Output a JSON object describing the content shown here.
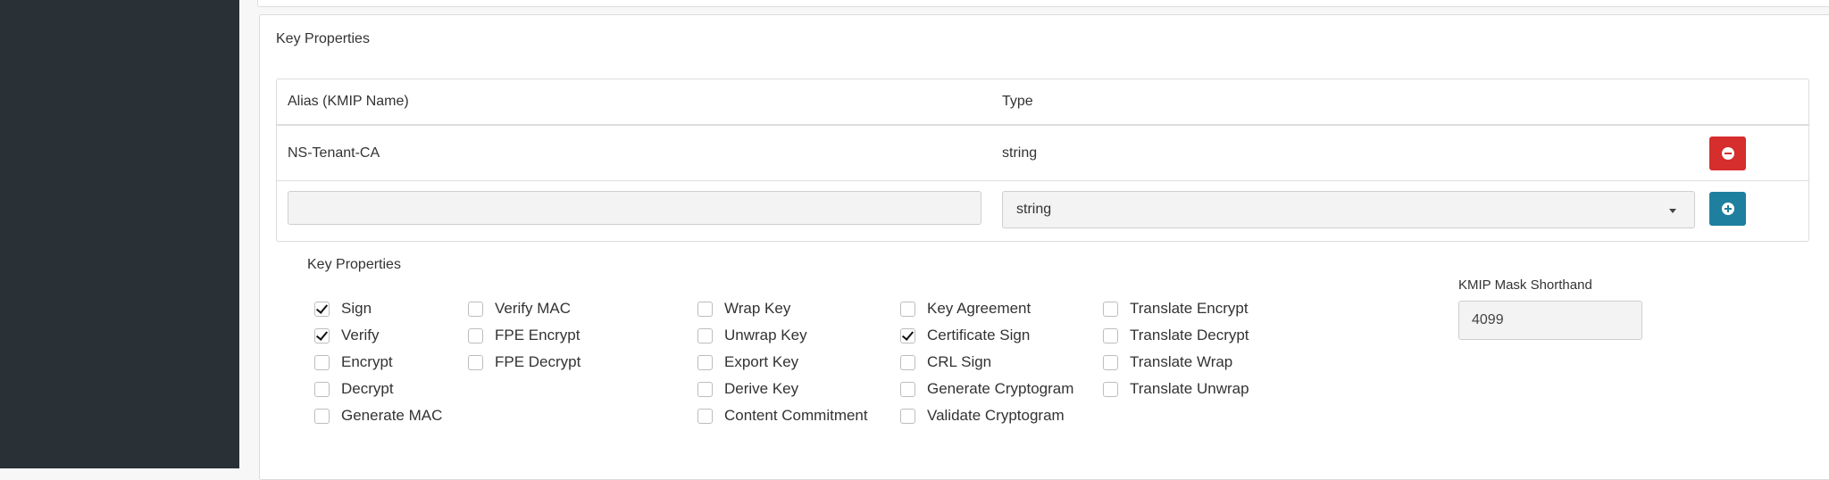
{
  "panel": {
    "title": "Key Properties"
  },
  "alias_table": {
    "headers": {
      "alias": "Alias (KMIP Name)",
      "type": "Type"
    },
    "rows": [
      {
        "alias": "NS-Tenant-CA",
        "type": "string"
      }
    ],
    "new_row": {
      "alias_value": "",
      "type_selected": "string"
    }
  },
  "key_properties": {
    "title": "Key Properties",
    "col1": [
      {
        "label": "Sign",
        "checked": true
      },
      {
        "label": "Verify",
        "checked": true
      },
      {
        "label": "Encrypt",
        "checked": false
      },
      {
        "label": "Decrypt",
        "checked": false
      },
      {
        "label": "Generate MAC",
        "checked": false
      }
    ],
    "col2": [
      {
        "label": "Verify MAC",
        "checked": false
      },
      {
        "label": "FPE Encrypt",
        "checked": false
      },
      {
        "label": "FPE Decrypt",
        "checked": false
      }
    ],
    "col3": [
      {
        "label": "Wrap Key",
        "checked": false
      },
      {
        "label": "Unwrap Key",
        "checked": false
      },
      {
        "label": "Export Key",
        "checked": false
      },
      {
        "label": "Derive Key",
        "checked": false
      },
      {
        "label": "Content Commitment",
        "checked": false
      }
    ],
    "col4": [
      {
        "label": "Key Agreement",
        "checked": false
      },
      {
        "label": "Certificate Sign",
        "checked": true
      },
      {
        "label": "CRL Sign",
        "checked": false
      },
      {
        "label": "Generate Cryptogram",
        "checked": false
      },
      {
        "label": "Validate Cryptogram",
        "checked": false
      }
    ],
    "col5": [
      {
        "label": "Translate Encrypt",
        "checked": false
      },
      {
        "label": "Translate Decrypt",
        "checked": false
      },
      {
        "label": "Translate Wrap",
        "checked": false
      },
      {
        "label": "Translate Unwrap",
        "checked": false
      }
    ]
  },
  "mask": {
    "label": "KMIP Mask Shorthand",
    "value": "4099"
  },
  "colors": {
    "sidebar": "#293137",
    "remove_button": "#d62d2d",
    "add_button": "#1f7f9f"
  },
  "icons": {
    "remove": "minus-circle-icon",
    "add": "plus-circle-icon",
    "dropdown": "caret-down-icon"
  }
}
